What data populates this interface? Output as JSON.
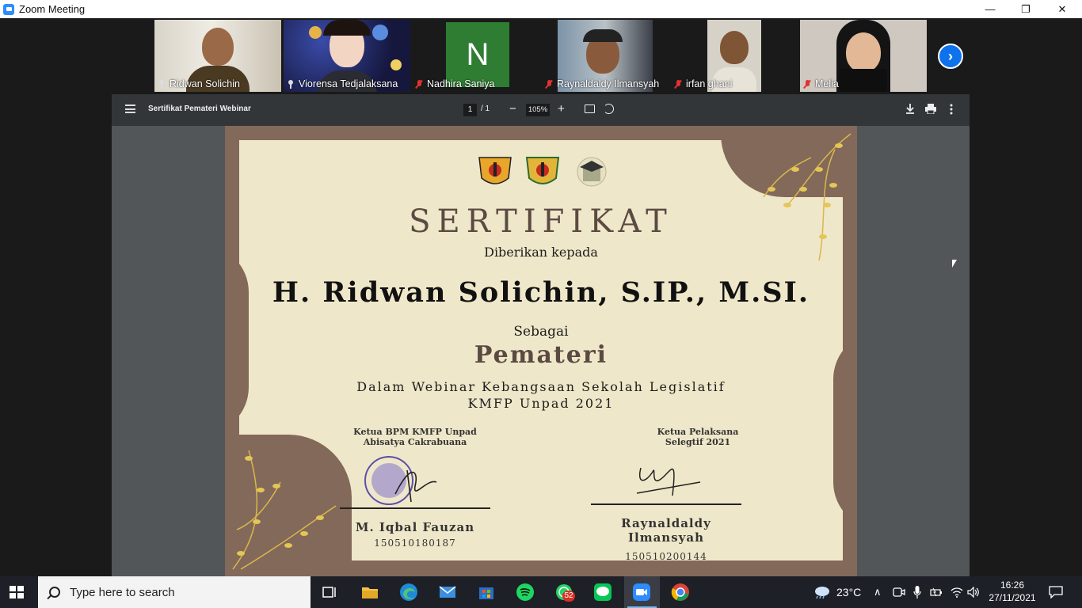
{
  "window": {
    "title": "Zoom Meeting",
    "minimize_icon": "—",
    "restore_icon": "❐",
    "close_icon": "✕"
  },
  "participants": [
    {
      "name": "Ridwan Solichin",
      "status": "pinned"
    },
    {
      "name": "Viorensa Tedjalaksana",
      "status": "pinned",
      "active": true
    },
    {
      "name": "Nadhira Saniya",
      "status": "muted",
      "avatar_letter": "N"
    },
    {
      "name": "Raynaldaldy Ilmansyah",
      "status": "muted"
    },
    {
      "name": "irfan ghani",
      "status": "muted"
    },
    {
      "name": "Melia",
      "status": "muted"
    }
  ],
  "pdf_viewer": {
    "doc_title": "Sertifikat Pemateri Webinar",
    "page_current": "1",
    "page_total": "/ 1",
    "zoom": "105%",
    "zoom_out": "−",
    "zoom_in": "+"
  },
  "certificate": {
    "heading": "SERTIFIKAT",
    "given_to": "Diberikan kepada",
    "recipient": "H. Ridwan Solichin, S.IP., M.SI.",
    "as_label": "Sebagai",
    "role": "Pemateri",
    "event_line1": "Dalam Webinar Kebangsaan Sekolah Legislatif",
    "event_line2": "KMFP Unpad 2021",
    "signer_left": {
      "title1": "Ketua BPM KMFP Unpad",
      "title2": "Abisatya Cakrabuana",
      "name": "M. Iqbal Fauzan",
      "id": "150510180187"
    },
    "signer_right": {
      "title1": "Ketua Pelaksana",
      "title2": "Selegtif 2021",
      "name": "Raynaldaldy Ilmansyah",
      "id": "150510200144"
    }
  },
  "taskbar": {
    "search_placeholder": "Type here to search",
    "whatsapp_badge": "52",
    "temperature": "23°C",
    "time": "16:26",
    "date": "27/11/2021"
  },
  "colors": {
    "zoom_blue": "#2d8cff",
    "cert_brown": "#83695a",
    "cert_cream": "#efe7c9",
    "taskbar": "#1d2026"
  }
}
